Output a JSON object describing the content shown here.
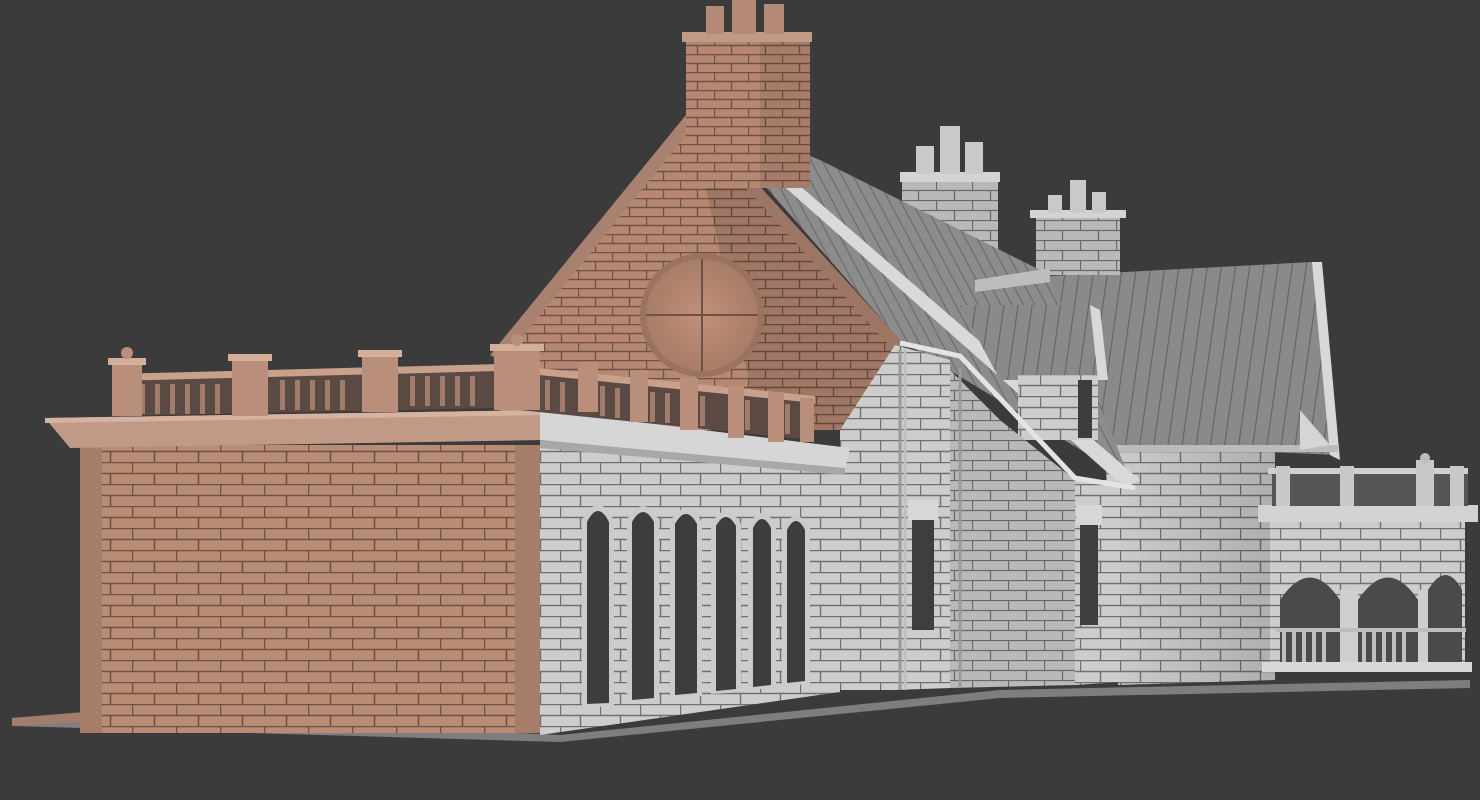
{
  "scene": {
    "subject": "victorian-brick-building-3d-render",
    "colors": {
      "background": "#3b3b3b",
      "brick_warm": "#b78a74",
      "brick_warm_dark": "#8e6a59",
      "brick_grey": "#cfcfcf",
      "brick_grey_dark": "#9a9a9a",
      "mortar_warm": "#6e5246",
      "mortar_grey": "#6f6f6f",
      "roof": "#8a8a8a",
      "roof_dark": "#5e5e5e",
      "window_glass": "#3a3a3a"
    }
  }
}
